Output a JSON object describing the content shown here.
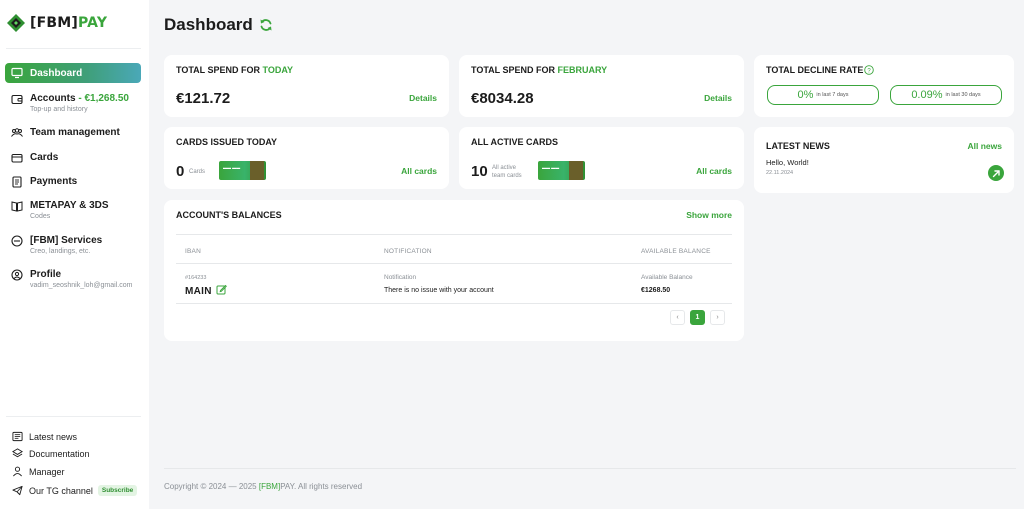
{
  "brand": {
    "bracket_left": "[",
    "fbm": "FBM",
    "bracket_right": "]",
    "pay": "PAY"
  },
  "sidebar": {
    "items": [
      {
        "label": "Dashboard"
      },
      {
        "label": "Accounts",
        "balance": " - €1,268.50",
        "sub": "Top-up and history"
      },
      {
        "label": "Team management"
      },
      {
        "label": "Cards"
      },
      {
        "label": "Payments"
      },
      {
        "label": "METAPAY & 3DS",
        "sub": "Codes"
      },
      {
        "label": "[FBM] Services",
        "sub": "Creo, landings, etc."
      },
      {
        "label": "Profile",
        "sub": "vadim_seoshnik_loh@gmail.com"
      }
    ],
    "bottom": [
      {
        "label": "Latest news"
      },
      {
        "label": "Documentation"
      },
      {
        "label": "Manager"
      },
      {
        "label": "Our TG channel",
        "badge": "Subscribe"
      }
    ]
  },
  "header": {
    "title": "Dashboard"
  },
  "spend_today": {
    "prefix": "TOTAL SPEND FOR ",
    "period": "TODAY",
    "amount": "€121.72",
    "link": "Details"
  },
  "spend_month": {
    "prefix": "TOTAL SPEND FOR ",
    "period": "FEBRUARY",
    "amount": "€8034.28",
    "link": "Details"
  },
  "decline": {
    "title": "TOTAL DECLINE RATE",
    "rates": [
      {
        "value": "0%",
        "period": "in last 7 days"
      },
      {
        "value": "0.09%",
        "period": "in last 30 days"
      }
    ]
  },
  "cards_today": {
    "title": "CARDS ISSUED TODAY",
    "count": "0",
    "sub": "Cards",
    "link": "All cards"
  },
  "cards_active": {
    "title": "ALL ACTIVE CARDS",
    "count": "10",
    "sub_line1": "All active",
    "sub_line2": "team cards",
    "link": "All cards"
  },
  "news": {
    "title": "LATEST NEWS",
    "link": "All news",
    "item_title": "Hello, World!",
    "item_date": "22.11.2024"
  },
  "balances": {
    "title": "ACCOUNT'S BALANCES",
    "link": "Show more",
    "columns": [
      "IBAN",
      "NOTIFICATION",
      "AVAILABLE BALANCE"
    ],
    "row": {
      "iban_id": "#164233",
      "name": "MAIN",
      "notification_label": "Notification",
      "notification_text": "There is no issue with your account",
      "balance_label": "Available Balance",
      "balance": "€1268.50"
    },
    "pager": {
      "prev": "‹",
      "current": "1",
      "next": "›"
    }
  },
  "footer": {
    "text_before": "Copyright © 2024 — 2025 ",
    "brand_fbm": "[FBM]",
    "brand_pay": "PAY",
    "text_after": ". All rights reserved"
  },
  "colors": {
    "accent": "#3aa53c",
    "background": "#f4f5f7"
  }
}
